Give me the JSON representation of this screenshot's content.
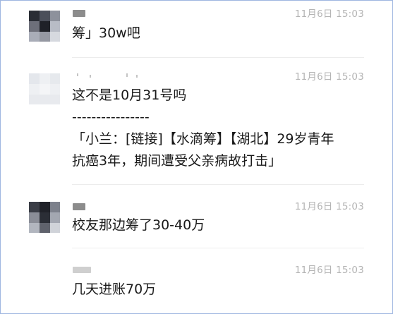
{
  "messages": [
    {
      "time": "11月6日 15:03",
      "lines": [
        "筹」30w吧"
      ]
    },
    {
      "time": "11月6日 15:03",
      "lines": [
        "这不是10月31号吗",
        "----------------",
        "「小兰：[链接]【水滴筹】【湖北】29岁青年",
        "抗癌3年，期间遭受父亲病故打击」"
      ]
    },
    {
      "time": "11月6日 15:03",
      "lines": [
        "校友那边筹了30-40万"
      ]
    },
    {
      "time": "11月6日 15:03",
      "lines": [
        "几天进账70万"
      ]
    }
  ]
}
